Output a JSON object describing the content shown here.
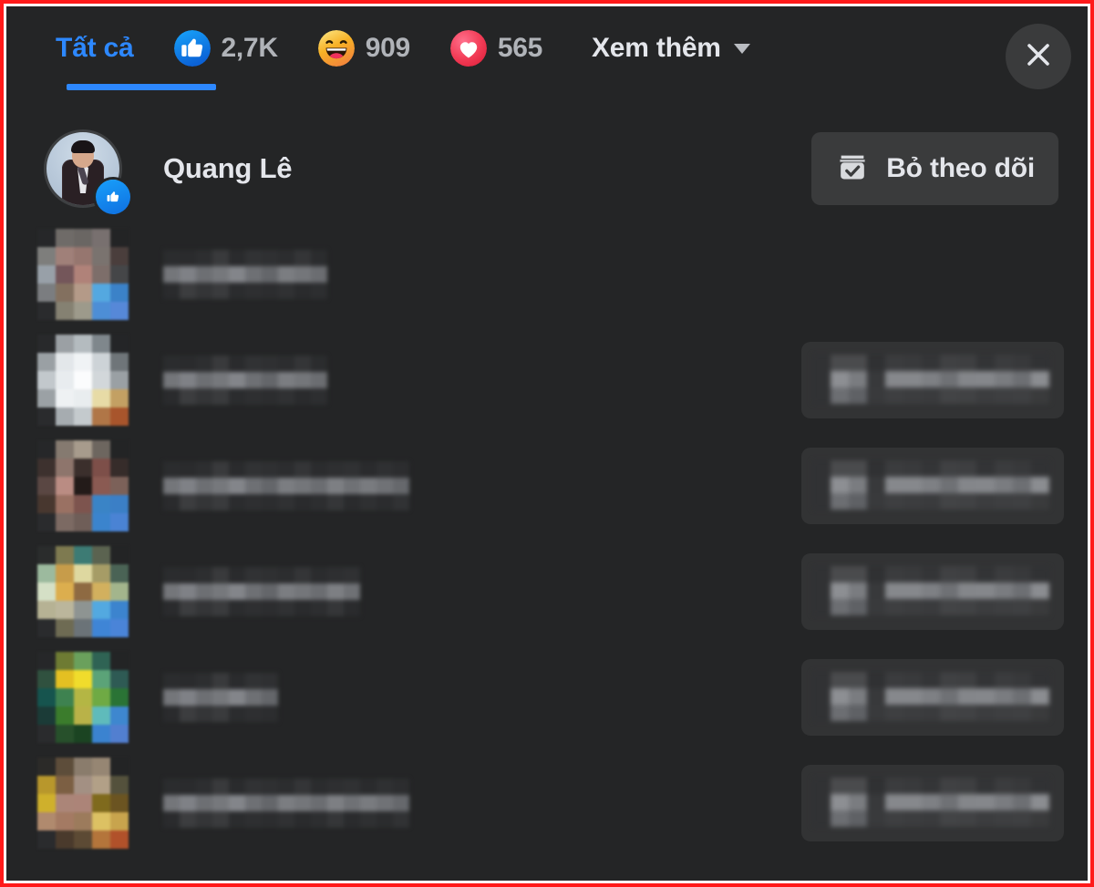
{
  "annotation": {
    "border_color": "#ff1a1a",
    "inner_border_color": "#ffffff"
  },
  "theme": {
    "background": "#242526",
    "surface": "#3a3b3c",
    "accent": "#2d88ff",
    "text_primary": "#e4e6eb",
    "text_secondary": "#b0b3b8",
    "like_blue": "#1b74e4",
    "haha_yellow": "#f7b125",
    "love_red": "#f33e58"
  },
  "dialog": {
    "tabs": [
      {
        "id": "all",
        "label": "Tất cả",
        "icon": "",
        "count": "",
        "active": true
      },
      {
        "id": "like",
        "label": "",
        "icon": "thumbs-up-reaction-icon",
        "count": "2,7K",
        "active": false
      },
      {
        "id": "haha",
        "label": "",
        "icon": "haha-reaction-icon",
        "count": "909",
        "active": false
      },
      {
        "id": "love",
        "label": "",
        "icon": "love-heart-reaction-icon",
        "count": "565",
        "active": false
      }
    ],
    "more": {
      "label": "Xem thêm",
      "icon": "chevron-down-icon"
    },
    "close": {
      "icon": "close-icon",
      "label": "×"
    }
  },
  "list": {
    "rows": [
      {
        "censored": false,
        "name": "Quang Lê",
        "avatar_icon": "profile-avatar",
        "badge_icon": "like-reaction-badge-icon",
        "action": {
          "label": "Bỏ theo dõi",
          "icon": "following-check-icon",
          "visible": true
        }
      },
      {
        "censored": true,
        "name": "",
        "name_width_cols": 10,
        "avatar_colors": [
          "#262729",
          "#6f6b68",
          "#6a6663",
          "#78706f",
          "#232425",
          "#7e7e7c",
          "#a08079",
          "#96766f",
          "#7a736f",
          "#4a3e3c",
          "#98a0a8",
          "#74565a",
          "#b08279",
          "#7d6e6a",
          "#454648",
          "#7b7d80",
          "#83705f",
          "#b49a88",
          "#54a8e0",
          "#3b82c8",
          "#2a2b2d",
          "#858172",
          "#9d9a8b",
          "#4d8ed6",
          "#5688d8"
        ],
        "action": {
          "label": "",
          "icon": "",
          "visible": false
        }
      },
      {
        "censored": true,
        "name": "",
        "name_width_cols": 10,
        "avatar_colors": [
          "#28292b",
          "#9ba0a4",
          "#b4bbbf",
          "#7f878c",
          "#242527",
          "#9aa0a4",
          "#e3e7ea",
          "#f0f3f5",
          "#cdd3d7",
          "#6f7579",
          "#c2c8cc",
          "#e8ecef",
          "#fbfcfd",
          "#d2d7da",
          "#9aa0a4",
          "#9ba1a5",
          "#eef1f3",
          "#e9edef",
          "#e7dba6",
          "#c3a063",
          "#2a2b2d",
          "#a6acb0",
          "#c4cacd",
          "#b07647",
          "#a8552c"
        ],
        "action": {
          "label": "",
          "icon": "",
          "visible": true
        }
      },
      {
        "censored": true,
        "name": "",
        "name_width_cols": 15,
        "avatar_colors": [
          "#262729",
          "#857a70",
          "#a79b8c",
          "#6d665f",
          "#232425",
          "#3d312e",
          "#8e756c",
          "#3b2f2c",
          "#7d4f49",
          "#362c2a",
          "#5a4743",
          "#ba8c83",
          "#231b19",
          "#8a5a52",
          "#7c6159",
          "#48372f",
          "#9a7163",
          "#7d544e",
          "#3a84c6",
          "#3b7fc6",
          "#2a2b2d",
          "#7c6a63",
          "#6f5e58",
          "#3b84cd",
          "#4a83d4"
        ],
        "action": {
          "label": "",
          "icon": "",
          "visible": true
        }
      },
      {
        "censored": true,
        "name": "",
        "name_width_cols": 12,
        "avatar_colors": [
          "#2a2c2c",
          "#7e7a50",
          "#3d7b74",
          "#5b6350",
          "#232425",
          "#9cba9e",
          "#c79c4a",
          "#ded8a0",
          "#a69c66",
          "#4a6355",
          "#d5e0c6",
          "#dcae4e",
          "#8e6a42",
          "#d2b05e",
          "#a3b58c",
          "#b6b294",
          "#bbb69c",
          "#8e9492",
          "#53a9e0",
          "#3c84ce",
          "#2a2b2d",
          "#6e6b53",
          "#6b7378",
          "#3f85d6",
          "#4a84d8"
        ],
        "action": {
          "label": "",
          "icon": "",
          "visible": true
        }
      },
      {
        "censored": true,
        "name": "",
        "name_width_cols": 7,
        "avatar_colors": [
          "#262729",
          "#6e7b33",
          "#6aa05c",
          "#2f6354",
          "#232425",
          "#30513f",
          "#e4c022",
          "#f0dc2c",
          "#5ba378",
          "#2e5a54",
          "#16544e",
          "#3e8250",
          "#b4b644",
          "#6faa44",
          "#2a7335",
          "#1b3b37",
          "#3b7c2c",
          "#b9b248",
          "#5fbbbb",
          "#3e87cf",
          "#2a2b2d",
          "#27502b",
          "#1b4422",
          "#3b83d0",
          "#527fd0"
        ],
        "action": {
          "label": "",
          "icon": "",
          "visible": true
        }
      },
      {
        "censored": true,
        "name": "",
        "name_width_cols": 15,
        "avatar_colors": [
          "#2b2a28",
          "#5d4d3a",
          "#8a7c6c",
          "#968673",
          "#232425",
          "#b8972c",
          "#7c5f43",
          "#a39083",
          "#b2a087",
          "#54513c",
          "#cfb02c",
          "#ab8578",
          "#ac8478",
          "#7f6a1d",
          "#6b5421",
          "#b08a6e",
          "#a47a63",
          "#9c7b5c",
          "#dcc163",
          "#c8a44d",
          "#2a2b2d",
          "#4a3a2c",
          "#5c4a34",
          "#b4753b",
          "#b1512a"
        ],
        "action": {
          "label": "",
          "icon": "",
          "visible": true
        }
      }
    ],
    "censored_name_colors": {
      "top": [
        "#2b2c2e",
        "#2a2b2d",
        "#2d2e30",
        "#393a3c",
        "#2a2b2d",
        "#313234",
        "#2f3032",
        "#2c2d2f",
        "#343537",
        "#2b2c2e",
        "#2e2f31",
        "#303133",
        "#2a2b2d",
        "#2f3032",
        "#2c2d2f"
      ],
      "middle": [
        "#74767a",
        "#7f8186",
        "#6d6f73",
        "#76787c",
        "#83858a",
        "#6e7074",
        "#64666a",
        "#7b7d81",
        "#74767a",
        "#6b6d71",
        "#7d7f83",
        "#6f7175",
        "#797b7f",
        "#707276",
        "#66686c"
      ],
      "bottom": [
        "#2a2b2d",
        "#3c3d3f",
        "#343537",
        "#3a3b3d",
        "#2b2c2e",
        "#2e2f31",
        "#2c2d2f",
        "#303133",
        "#2a2b2d",
        "#2d2e30",
        "#353638",
        "#2a2b2d",
        "#2f3032",
        "#2b2c2e",
        "#313234"
      ]
    },
    "censored_button_colors": {
      "top": [
        "#313234",
        "#4a4b4d",
        "#4a4b4d",
        "#303133",
        "#3b3c3e",
        "#393a3c",
        "#343537",
        "#404143",
        "#3e3f41",
        "#333436",
        "#3b3c3e",
        "#38393b",
        "#313234"
      ],
      "middle": [
        "#313234",
        "#8d8f93",
        "#7a7c80",
        "#38393b",
        "#86888c",
        "#86888c",
        "#7e8084",
        "#6f7175",
        "#84868a",
        "#85878b",
        "#7a7c80",
        "#6d6f73",
        "#8b8d91"
      ],
      "bottom": [
        "#313234",
        "#6c6e72",
        "#5f6165",
        "#393a3c",
        "#3e3f41",
        "#3c3d3f",
        "#3a3b3d",
        "#434446",
        "#414244",
        "#3c3d3f",
        "#3e3f41",
        "#3f4042",
        "#3a3b3c"
      ]
    }
  }
}
